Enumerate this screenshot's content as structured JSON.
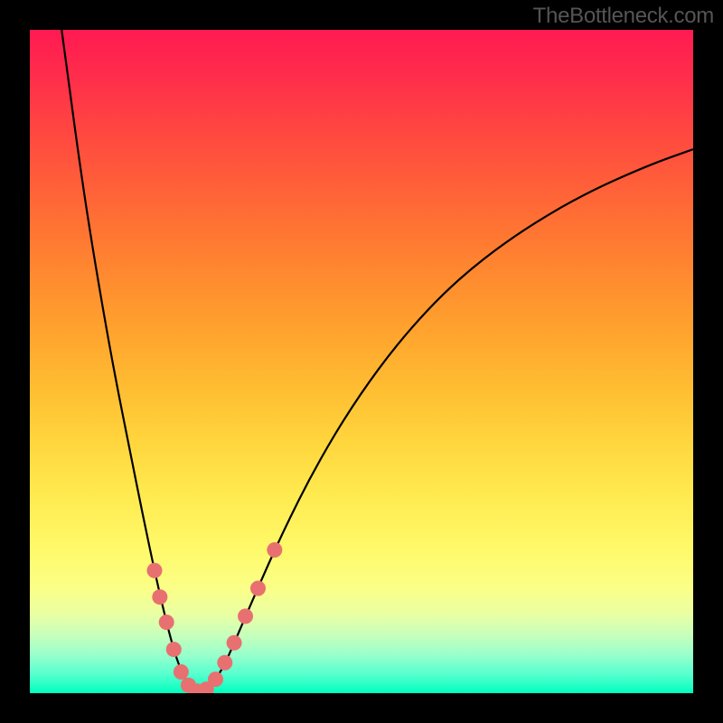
{
  "watermark": "TheBottleneck.com",
  "chart_data": {
    "type": "line",
    "title": "",
    "xlabel": "",
    "ylabel": "",
    "xlim": [
      0,
      100
    ],
    "ylim": [
      0,
      100
    ],
    "curve_points": [
      {
        "x": 4.8,
        "y": 100.0
      },
      {
        "x": 6.0,
        "y": 91.0
      },
      {
        "x": 7.5,
        "y": 80.0
      },
      {
        "x": 9.0,
        "y": 70.0
      },
      {
        "x": 11.0,
        "y": 58.0
      },
      {
        "x": 13.0,
        "y": 47.0
      },
      {
        "x": 15.0,
        "y": 37.0
      },
      {
        "x": 17.0,
        "y": 27.0
      },
      {
        "x": 19.0,
        "y": 17.5
      },
      {
        "x": 21.0,
        "y": 9.0
      },
      {
        "x": 22.5,
        "y": 4.0
      },
      {
        "x": 24.0,
        "y": 1.0
      },
      {
        "x": 25.5,
        "y": 0.2
      },
      {
        "x": 27.0,
        "y": 0.8
      },
      {
        "x": 29.0,
        "y": 3.5
      },
      {
        "x": 31.0,
        "y": 8.0
      },
      {
        "x": 34.0,
        "y": 15.0
      },
      {
        "x": 38.0,
        "y": 24.0
      },
      {
        "x": 43.0,
        "y": 34.0
      },
      {
        "x": 49.0,
        "y": 44.0
      },
      {
        "x": 56.0,
        "y": 53.5
      },
      {
        "x": 64.0,
        "y": 62.0
      },
      {
        "x": 73.0,
        "y": 69.0
      },
      {
        "x": 83.0,
        "y": 75.0
      },
      {
        "x": 93.0,
        "y": 79.5
      },
      {
        "x": 100.0,
        "y": 82.0
      }
    ],
    "marker_points": [
      {
        "x": 18.8,
        "y": 18.5
      },
      {
        "x": 19.6,
        "y": 14.5
      },
      {
        "x": 20.6,
        "y": 10.7
      },
      {
        "x": 21.7,
        "y": 6.6
      },
      {
        "x": 22.8,
        "y": 3.2
      },
      {
        "x": 23.9,
        "y": 1.2
      },
      {
        "x": 25.2,
        "y": 0.3
      },
      {
        "x": 26.6,
        "y": 0.6
      },
      {
        "x": 28.0,
        "y": 2.1
      },
      {
        "x": 29.4,
        "y": 4.6
      },
      {
        "x": 30.8,
        "y": 7.6
      },
      {
        "x": 32.5,
        "y": 11.6
      },
      {
        "x": 34.4,
        "y": 15.8
      },
      {
        "x": 36.9,
        "y": 21.6
      }
    ],
    "marker_color": "#e97070",
    "curve_color": "#000000"
  }
}
